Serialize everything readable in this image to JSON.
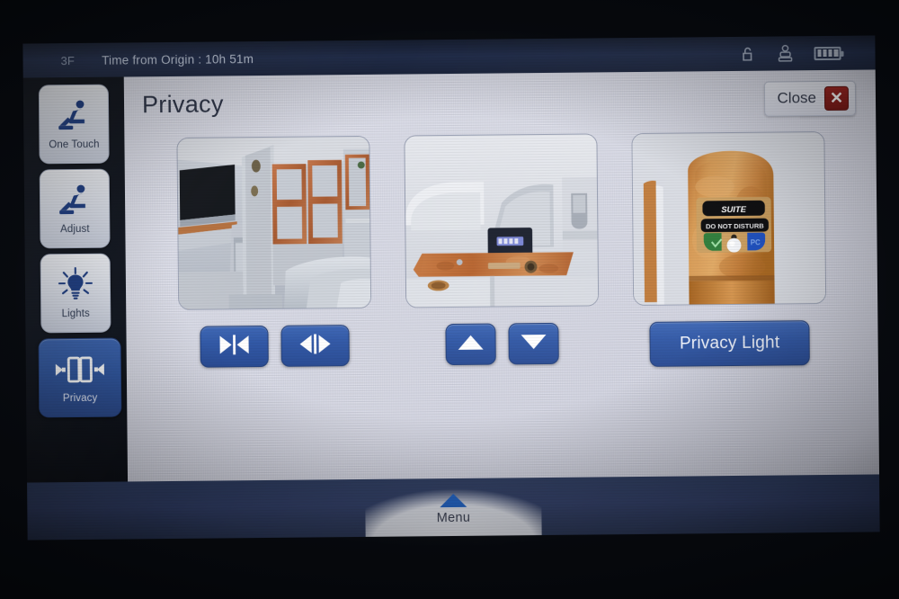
{
  "statusbar": {
    "seat": "3F",
    "time_label": "Time from Origin : 10h 51m",
    "icons": {
      "unlock": "unlock-icon",
      "attendant": "call-attendant-icon",
      "battery": "battery-icon"
    },
    "battery_bars": 4
  },
  "sidebar": {
    "items": [
      {
        "label": "One Touch",
        "icon": "seat-recline-icon",
        "selected": false
      },
      {
        "label": "Adjust",
        "icon": "seat-recline-icon",
        "selected": false
      },
      {
        "label": "Lights",
        "icon": "light-bulb-icon",
        "selected": false
      },
      {
        "label": "Privacy",
        "icon": "privacy-divider-icon",
        "selected": true
      }
    ]
  },
  "panel": {
    "title": "Privacy",
    "close_label": "Close",
    "close_icon": "close-x-icon"
  },
  "thumbnails": [
    {
      "name": "suite-divider-photo",
      "alt": "Suite interior with wood-framed privacy divider doors closed",
      "labels": []
    },
    {
      "name": "seat-console-photo",
      "alt": "Seat console with burl wood armrest and control display",
      "labels": []
    },
    {
      "name": "suite-door-panel-photo",
      "alt": "Burl wood suite door panel with indicator lights",
      "labels": [
        "SUITE",
        "DO NOT DISTURB",
        "PC"
      ]
    }
  ],
  "controls": {
    "group_divider": [
      {
        "label": "",
        "icon": "divider-open-icon"
      },
      {
        "label": "",
        "icon": "divider-close-icon"
      }
    ],
    "group_height": [
      {
        "label": "",
        "icon": "arrow-up-icon"
      },
      {
        "label": "",
        "icon": "arrow-down-icon"
      }
    ],
    "privacy_light": {
      "label": "Privacy Light"
    }
  },
  "bottombar": {
    "menu_label": "Menu",
    "menu_icon": "triangle-up-icon"
  },
  "colors": {
    "accent_blue": "#2f56a0",
    "button_blue": "#3259a7",
    "close_red": "#8a1d19",
    "statusbar_navy": "#253253",
    "bottombar_navy": "#32406a",
    "panel_bg": "#dfe0ea"
  }
}
